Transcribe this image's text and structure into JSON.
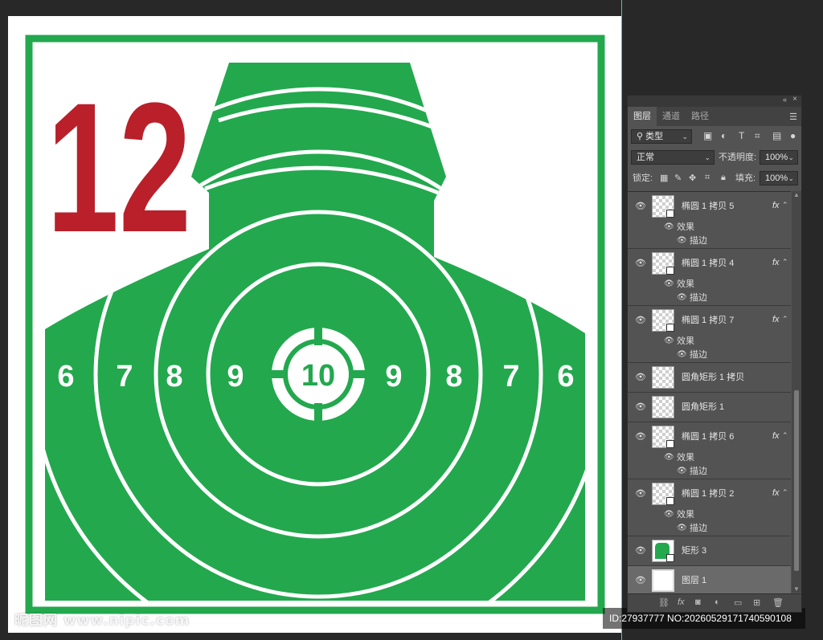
{
  "target": {
    "number": "12",
    "center_label": "10",
    "ring_labels": [
      "6",
      "7",
      "8",
      "9",
      "9",
      "8",
      "7",
      "6"
    ],
    "colors": {
      "green": "#23a84e",
      "red": "#b9202a",
      "white": "#ffffff"
    }
  },
  "watermark": {
    "site": "昵图网 www.nipic.com",
    "id_text": "ID:27937777 NO:20260529171740590108"
  },
  "panel": {
    "collapse_glyph": "«",
    "close_glyph": "×",
    "tabs": [
      {
        "label": "图层",
        "active": true
      },
      {
        "label": "通道",
        "active": false
      },
      {
        "label": "路径",
        "active": false
      }
    ],
    "menu_icon": "hamburger-menu-icon",
    "filter": {
      "value": "类型"
    },
    "blend_mode": {
      "value": "正常"
    },
    "opacity": {
      "label": "不透明度:",
      "value": "100%"
    },
    "lock": {
      "label": "锁定:"
    },
    "fill": {
      "label": "填充:",
      "value": "100%"
    },
    "effects_label": "效果",
    "stroke_label": "描边",
    "fx_label": "fx",
    "layers": [
      {
        "name": "椭圆 1 拷贝 5",
        "fx": true,
        "thumb": "checker"
      },
      {
        "name": "椭圆 1 拷贝 4",
        "fx": true,
        "thumb": "checker"
      },
      {
        "name": "椭圆 1 拷贝 7",
        "fx": true,
        "thumb": "checker"
      },
      {
        "name": "圆角矩形 1 拷贝",
        "fx": false,
        "thumb": "checker"
      },
      {
        "name": "圆角矩形 1",
        "fx": false,
        "thumb": "checker"
      },
      {
        "name": "椭圆 1 拷贝 6",
        "fx": true,
        "thumb": "checker"
      },
      {
        "name": "椭圆 1 拷贝 2",
        "fx": true,
        "thumb": "checker"
      },
      {
        "name": "矩形 3",
        "fx": false,
        "thumb": "green"
      },
      {
        "name": "图层 1",
        "fx": false,
        "thumb": "white",
        "selected": true
      }
    ],
    "footer_icons": [
      "link-icon",
      "fx-icon",
      "mask-icon",
      "adjustment-icon",
      "folder-icon",
      "new-layer-icon",
      "trash-icon"
    ]
  }
}
